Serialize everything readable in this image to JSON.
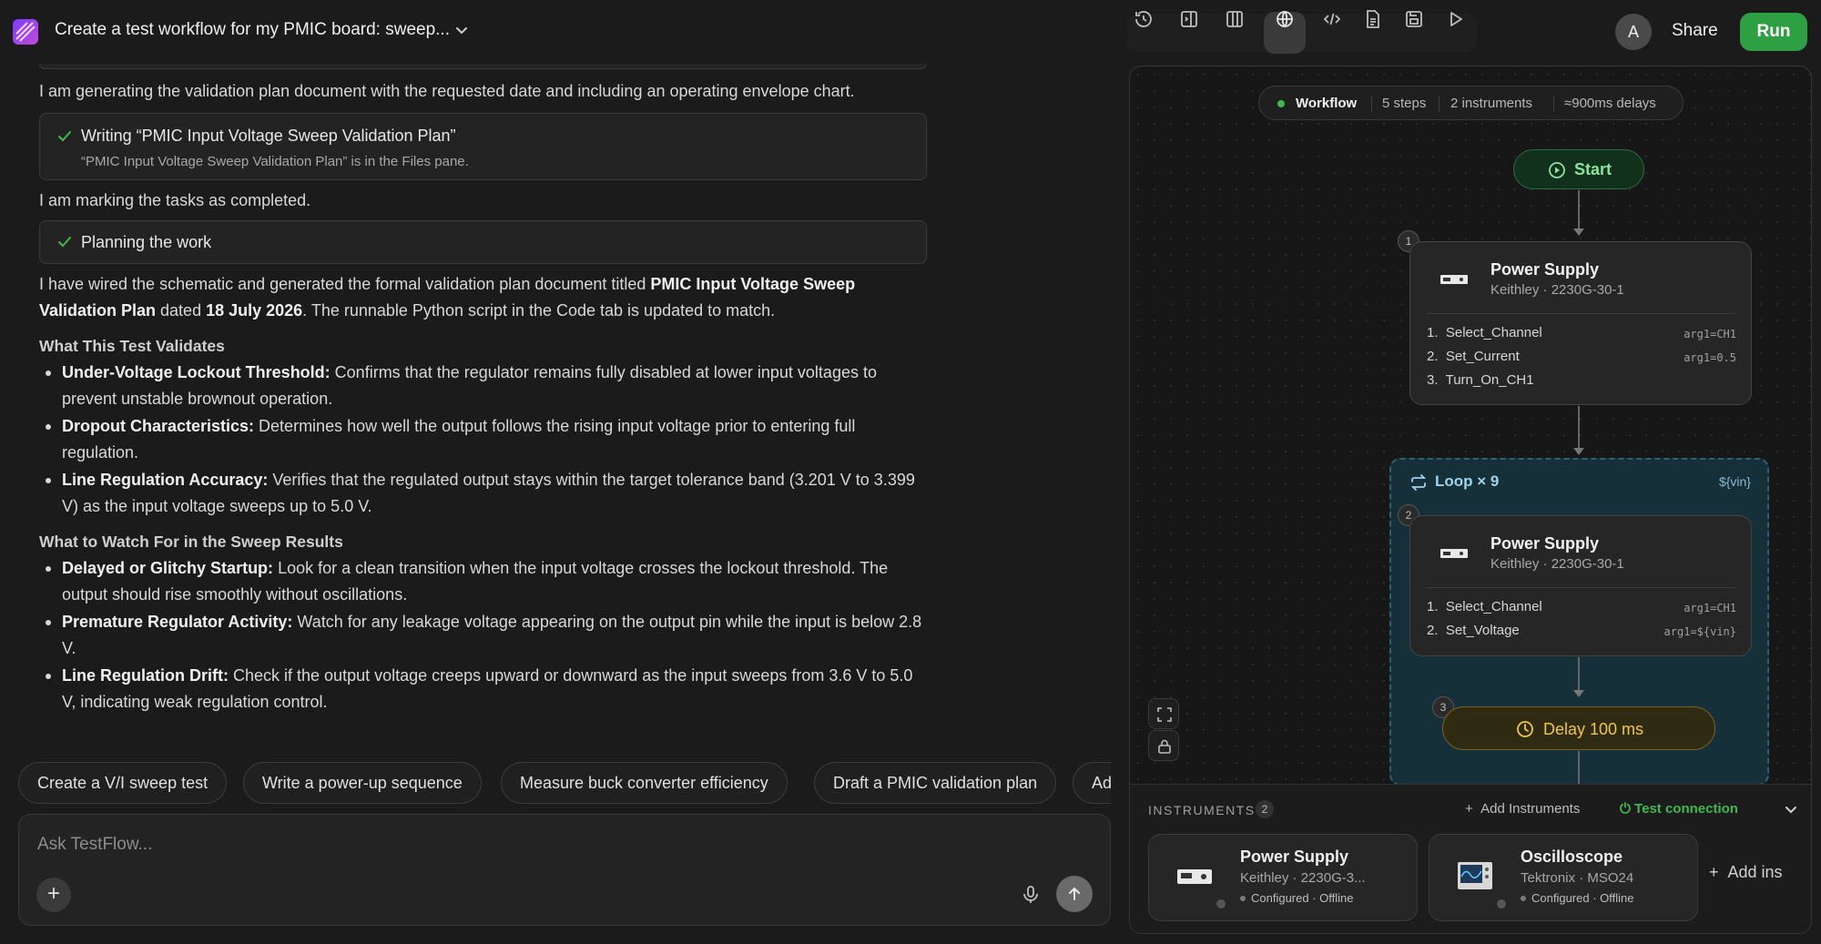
{
  "app": {
    "title": "Create a test workflow for my PMIC board: sweep...",
    "avatar_initial": "A",
    "share_label": "Share",
    "run_label": "Run",
    "accent_color": "#2ea043"
  },
  "toolbar": {
    "icons": [
      "history-icon",
      "panel-left-icon",
      "columns-icon",
      "globe-icon",
      "code-icon",
      "document-icon",
      "save-icon",
      "play-icon"
    ],
    "active": "globe-icon"
  },
  "chat": {
    "intro": "I am generating the validation plan document with the requested date and including an operating envelope chart.",
    "task1": {
      "title": "Writing “PMIC Input Voltage Sweep Validation Plan”",
      "subtitle": "“PMIC Input Voltage Sweep Validation Plan” is in the Files pane."
    },
    "marking": "I am marking the tasks as completed.",
    "task2": {
      "title": "Planning the work"
    },
    "summary": {
      "p1": "I have wired the schematic and generated the formal validation plan document titled ",
      "doc": "PMIC Input Voltage Sweep Validation Plan",
      "p2": " dated ",
      "date": "18 July 2026",
      "p3": ". The runnable Python script in the Code tab is updated to match."
    },
    "section1": {
      "heading": "What This Test Validates",
      "bullets": [
        {
          "bold": "Under-Voltage Lockout Threshold:",
          "text": " Confirms that the regulator remains fully disabled at lower input voltages to prevent unstable brownout operation."
        },
        {
          "bold": "Dropout Characteristics:",
          "text": " Determines how well the output follows the rising input voltage prior to entering full regulation."
        },
        {
          "bold": "Line Regulation Accuracy:",
          "text": " Verifies that the regulated output stays within the target tolerance band (3.201 V to 3.399 V) as the input voltage sweeps up to 5.0 V."
        }
      ]
    },
    "section2": {
      "heading": "What to Watch For in the Sweep Results",
      "bullets": [
        {
          "bold": "Delayed or Glitchy Startup:",
          "text": " Look for a clean transition when the input voltage crosses the lockout threshold. The output should rise smoothly without oscillations."
        },
        {
          "bold": "Premature Regulator Activity:",
          "text": " Watch for any leakage voltage appearing on the output pin while the input is below 2.8 V."
        },
        {
          "bold": "Line Regulation Drift:",
          "text": " Check if the output voltage creeps upward or downward as the input sweeps from 3.6 V to 5.0 V, indicating weak regulation control."
        }
      ]
    },
    "suggestions": [
      "Create a V/I sweep test",
      "Write a power-up sequence",
      "Measure buck converter efficiency",
      "Draft a PMIC validation plan",
      "Ad"
    ],
    "composer_placeholder": "Ask TestFlow...",
    "plus_label": "+"
  },
  "workflow": {
    "summary": {
      "label": "Workflow",
      "steps": "5 steps",
      "instruments": "2 instruments",
      "delays": "≈900ms delays"
    },
    "start_label": "Start",
    "node1": {
      "number": "1",
      "title": "Power Supply",
      "subtitle": "Keithley · 2230G-30-1",
      "commands": [
        {
          "n": "1.",
          "name": "Select_Channel",
          "arg": "arg1=CH1"
        },
        {
          "n": "2.",
          "name": "Set_Current",
          "arg": "arg1=0.5"
        },
        {
          "n": "3.",
          "name": "Turn_On_CH1",
          "arg": ""
        }
      ]
    },
    "loop": {
      "label": "Loop × 9",
      "variable": "${vin}"
    },
    "node2": {
      "number": "2",
      "title": "Power Supply",
      "subtitle": "Keithley · 2230G-30-1",
      "commands": [
        {
          "n": "1.",
          "name": "Select_Channel",
          "arg": "arg1=CH1"
        },
        {
          "n": "2.",
          "name": "Set_Voltage",
          "arg": "arg1=${vin}"
        }
      ]
    },
    "delay": {
      "number": "3",
      "label": "Delay 100 ms"
    }
  },
  "instruments": {
    "heading": "INSTRUMENTS",
    "count": "2",
    "add_label": "Add Instruments",
    "test_label": "Test connection",
    "items": [
      {
        "title": "Power Supply",
        "subtitle": "Keithley · 2230G-3...",
        "status": "Configured · Offline"
      },
      {
        "title": "Oscilloscope",
        "subtitle": "Tektronix · MSO24",
        "status": "Configured · Offline"
      }
    ],
    "add_more_label": "Add ins"
  }
}
